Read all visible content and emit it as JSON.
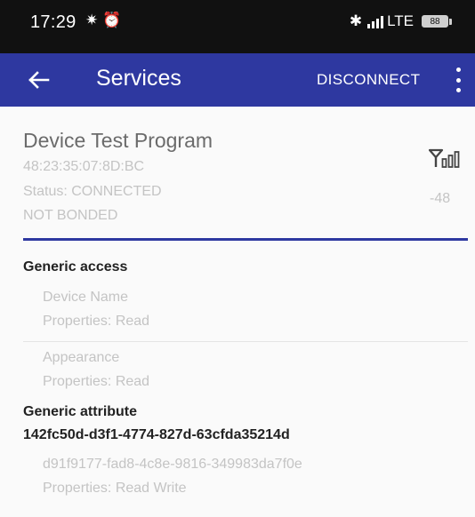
{
  "status_bar": {
    "time": "17:29",
    "lte_label": "LTE",
    "battery_level": "88"
  },
  "app_bar": {
    "title": "Services",
    "disconnect_label": "DISCONNECT",
    "color": "#2e38a0"
  },
  "device": {
    "name": "Device Test Program",
    "mac": "48:23:35:07:8D:BC",
    "status": "Status:  CONNECTED",
    "bond": "NOT BONDED",
    "rssi": "-48"
  },
  "services": [
    {
      "name": "Generic access",
      "characteristics": [
        {
          "name": "Device Name",
          "properties": "Properties: Read"
        },
        {
          "name": "Appearance",
          "properties": "Properties: Read"
        }
      ]
    },
    {
      "name": "Generic attribute",
      "characteristics": []
    },
    {
      "name": "142fc50d-d3f1-4774-827d-63cfda35214d",
      "characteristics": [
        {
          "name": "d91f9177-fad8-4c8e-9816-349983da7f0e",
          "properties": "Properties: Read Write"
        }
      ]
    }
  ]
}
